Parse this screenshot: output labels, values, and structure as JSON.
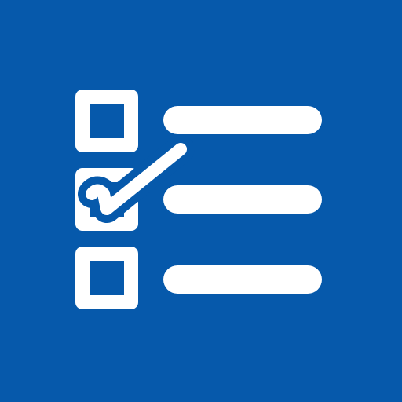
{
  "icon": {
    "name": "checklist-icon",
    "background_color": "#0659AB",
    "foreground_color": "#FFFFFF"
  },
  "checklist": {
    "items": [
      {
        "checked": false
      },
      {
        "checked": true
      },
      {
        "checked": false
      }
    ]
  }
}
